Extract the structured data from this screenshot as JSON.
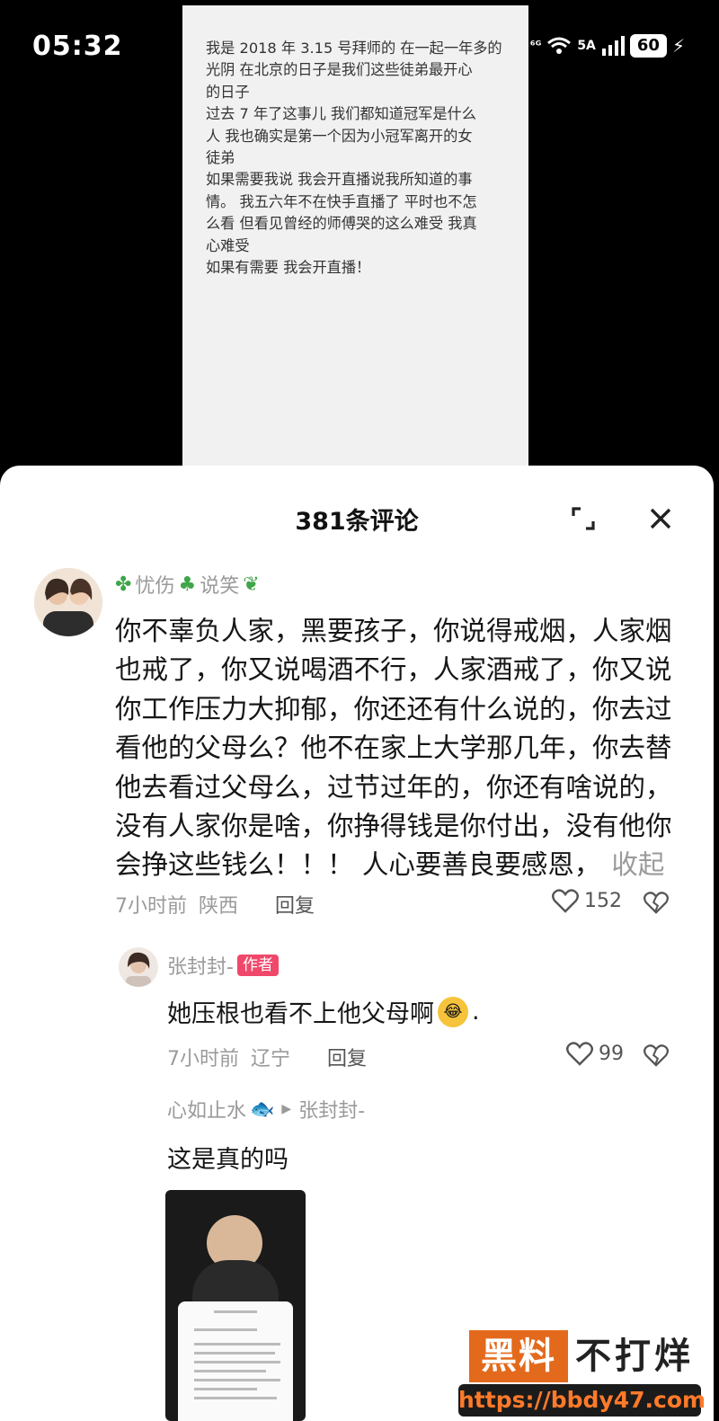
{
  "status_bar": {
    "time": "05:32",
    "network": "5A",
    "battery": "60"
  },
  "document": {
    "lines": [
      "我是 2018 年 3.15 号拜师的 在一起一年多的",
      "光阴 在北京的日子是我们这些徒弟最开心",
      "的日子",
      "过去 7 年了这事儿 我们都知道冠军是什么",
      "人 我也确实是第一个因为小冠军离开的女",
      "徒弟",
      "如果需要我说 我会开直播说我所知道的事",
      "情。 我五六年不在快手直播了 平时也不怎",
      "么看 但看见曾经的师傅哭的这么难受 我真",
      "心难受",
      "如果有需要 我会开直播！"
    ]
  },
  "comments_panel": {
    "title": "381条评论",
    "expand_icon": "expand-icon",
    "close_icon": "close-icon",
    "comment": {
      "username_part1": "忧伤",
      "username_part2": "说笑",
      "lines": [
        "你不辜负人家，黑要孩子，你说得戒烟，人家烟",
        "也戒了，你又说喝酒不行，人家酒戒了，你又说",
        "你工作压力大抑郁，你还还有什么说的，你去过",
        "看他的父母么？他不在家上大学那几年，你去替",
        "他去看过父母么，过节过年的，你还有啥说的，",
        "没有人家你是啥，你挣得钱是你付出，没有他你",
        "会挣这些钱么！！！ 人心要善良要感恩，"
      ],
      "collapse_label": "收起",
      "time": "7小时前",
      "location": "陕西",
      "reply_label": "回复",
      "likes": "152"
    },
    "reply": {
      "username": "张封封-",
      "badge": "作者",
      "text": "她压根也看不上他父母啊",
      "text_suffix": ".",
      "time": "7小时前",
      "location": "辽宁",
      "reply_label": "回复",
      "likes": "99"
    },
    "nested_reply": {
      "from": "心如止水",
      "to": "张封封-",
      "text": "这是真的吗"
    }
  },
  "watermark": {
    "box_text": "黑料",
    "right_text": "不打烊",
    "url": "https://bbdy47.com"
  },
  "colors": {
    "author_badge": "#f0486b",
    "watermark_orange": "#e36a1c"
  }
}
